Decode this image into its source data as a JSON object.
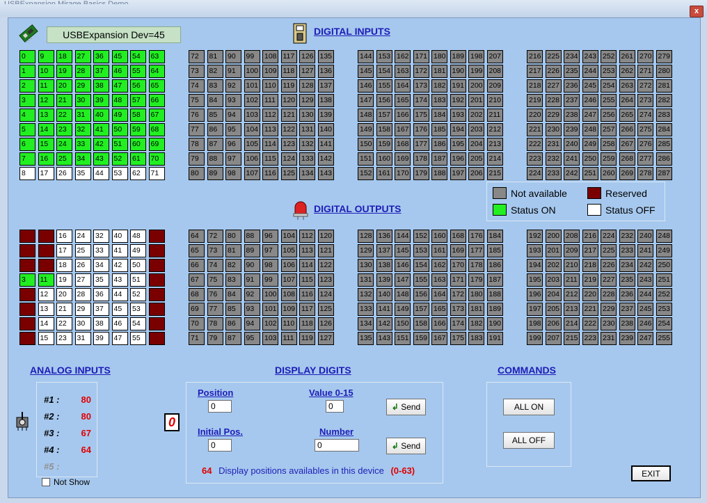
{
  "window": {
    "title": "USBExpansion  Mirage Basics  Demo",
    "close_label": "x"
  },
  "device_label": "USBExpansion Dev=45",
  "headers": {
    "digital_inputs": "DIGITAL INPUTS",
    "digital_outputs": "DIGITAL OUTPUTS",
    "analog_inputs": "ANALOG INPUTS",
    "display_digits": "DISPLAY DIGITS",
    "commands": "COMMANDS"
  },
  "legend": {
    "not_available": "Not available",
    "reserved": "Reserved",
    "status_on": "Status ON",
    "status_off": "Status OFF"
  },
  "status_colors": {
    "on": "#22ee22",
    "off": "#ffffff",
    "not_available": "#888888",
    "reserved": "#7a0000"
  },
  "inputs": {
    "start_nums": [
      0,
      72,
      144,
      216
    ],
    "column_step": 9,
    "rows": 9,
    "on_inputs": [
      0,
      1,
      2,
      3,
      4,
      5,
      6,
      7,
      9,
      10,
      11,
      12,
      13,
      14,
      15,
      16,
      18,
      19,
      20,
      21,
      22,
      23,
      24,
      25,
      27,
      28,
      29,
      30,
      31,
      32,
      33,
      34,
      36,
      37,
      38,
      39,
      40,
      41,
      42,
      43,
      45,
      46,
      47,
      48,
      49,
      50,
      51,
      52,
      54,
      55,
      56,
      57,
      58,
      59,
      60,
      61,
      63,
      64,
      65,
      66,
      67,
      68,
      69,
      70
    ],
    "off_inputs": [
      8,
      17,
      26,
      35,
      44,
      53,
      62,
      71
    ],
    "na_from": 72
  },
  "outputs": {
    "start_nums": [
      0,
      64,
      128,
      192
    ],
    "column_step": 8,
    "rows": 8,
    "group1_columns": [
      [
        0,
        1,
        2,
        3,
        4,
        5,
        6,
        7
      ],
      [
        8,
        9,
        10,
        11,
        12,
        13,
        14,
        15
      ],
      [
        16,
        17,
        18,
        19,
        20,
        21,
        22,
        23
      ],
      [
        24,
        25,
        26,
        27,
        28,
        29,
        30,
        31
      ],
      [
        32,
        33,
        34,
        35,
        36,
        37,
        38,
        39
      ],
      [
        40,
        41,
        42,
        43,
        44,
        45,
        46,
        47
      ],
      [
        48,
        49,
        50,
        51,
        52,
        53,
        54,
        55
      ],
      [
        56,
        57,
        58,
        59,
        60,
        61,
        62,
        63
      ]
    ],
    "reserved_outputs": [
      0,
      1,
      2,
      4,
      5,
      6,
      7,
      8,
      9,
      10,
      56,
      57,
      58,
      59,
      60,
      61,
      62,
      63
    ],
    "on_outputs": [
      3,
      11
    ],
    "na_from": 64
  },
  "analog": {
    "items": [
      {
        "label": "#1 :",
        "value": "80"
      },
      {
        "label": "#2 :",
        "value": "80"
      },
      {
        "label": "#3 :",
        "value": "67"
      },
      {
        "label": "#4 :",
        "value": "64"
      },
      {
        "label": "#5 :",
        "value": ""
      }
    ],
    "not_show_label": "Not Show",
    "not_show_checked": false
  },
  "display": {
    "position_label": "Position",
    "position_value": "0",
    "value_label": "Value 0-15",
    "value_value": "0",
    "send_label": "Send",
    "initial_pos_label": "Initial Pos.",
    "initial_pos_value": "0",
    "number_label": "Number",
    "number_value": "0",
    "digit_preview": "0",
    "positions_count": "64",
    "positions_text": "Display positions availables in this device",
    "positions_range": "(0-63)"
  },
  "commands": {
    "all_on_label": "ALL ON",
    "all_off_label": "ALL OFF"
  },
  "exit_label": "EXIT",
  "icons": {
    "device": "usb-board-icon",
    "inputs": "input-switch-icon",
    "outputs": "output-lamp-icon",
    "analog": "potentiometer-icon",
    "digit": "seven-segment-icon"
  }
}
